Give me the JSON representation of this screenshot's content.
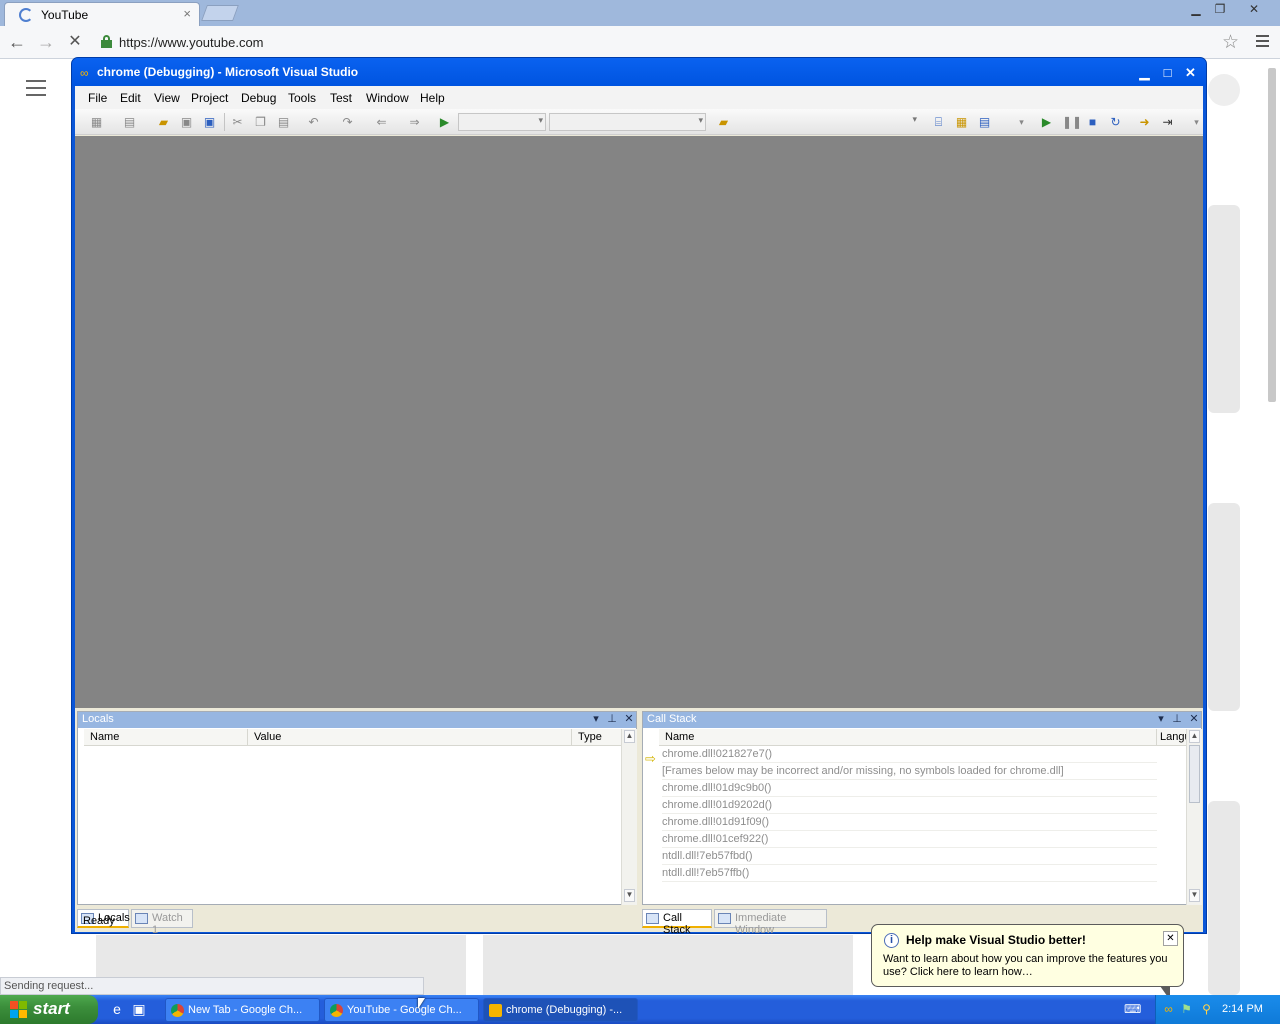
{
  "browser": {
    "tab_title": "YouTube",
    "tab_close": "×",
    "url": "https://www.youtube.com",
    "status_text": "Sending request..."
  },
  "vs": {
    "title": "chrome (Debugging) - Microsoft Visual Studio",
    "menu": [
      "File",
      "Edit",
      "View",
      "Project",
      "Debug",
      "Tools",
      "Test",
      "Window",
      "Help"
    ],
    "status": "Ready",
    "locals": {
      "title": "Locals",
      "columns": [
        "Name",
        "Value",
        "Type"
      ],
      "tabs": [
        "Locals",
        "Watch 1"
      ]
    },
    "call_stack": {
      "title": "Call Stack",
      "columns": [
        "Name",
        "Langu"
      ],
      "rows": [
        "chrome.dll!021827e7()",
        "[Frames below may be incorrect and/or missing, no symbols loaded for chrome.dll]",
        "chrome.dll!01d9c9b0()",
        "chrome.dll!01d9202d()",
        "chrome.dll!01d91f09()",
        "chrome.dll!01cef922()",
        "ntdll.dll!7eb57fbd()",
        "ntdll.dll!7eb57ffb()"
      ],
      "tabs": [
        "Call Stack",
        "Immediate Window"
      ]
    }
  },
  "balloon": {
    "title": "Help make Visual Studio better!",
    "body": "Want to learn about how you can improve the features you use? Click here to learn how…"
  },
  "taskbar": {
    "start_label": "start",
    "buttons": [
      "New Tab - Google Ch...",
      "YouTube - Google Ch...",
      "chrome (Debugging) -..."
    ],
    "clock": "2:14 PM"
  }
}
